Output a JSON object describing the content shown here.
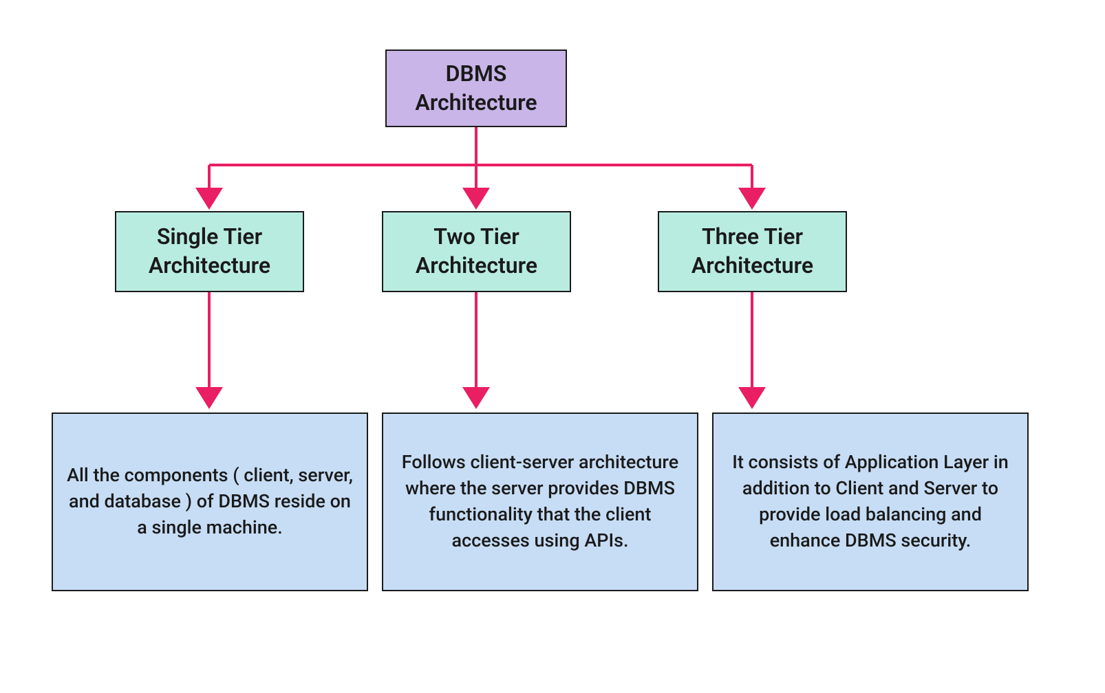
{
  "diagram": {
    "root": {
      "title": "DBMS Architecture"
    },
    "branches": [
      {
        "title": "Single Tier Architecture",
        "description": "All the components ( client, server, and database ) of DBMS reside on a single machine."
      },
      {
        "title": "Two Tier Architecture",
        "description": "Follows client-server architecture where the server provides DBMS functionality that the client accesses using APIs."
      },
      {
        "title": "Three Tier Architecture",
        "description": "It consists of Application Layer in addition to Client and Server to provide load balancing and enhance DBMS security."
      }
    ],
    "colors": {
      "root_bg": "#c9b5e8",
      "tier_bg": "#b9ece0",
      "desc_bg": "#c7ddf5",
      "arrow": "#e91e63",
      "border": "#1a1a1a"
    }
  }
}
